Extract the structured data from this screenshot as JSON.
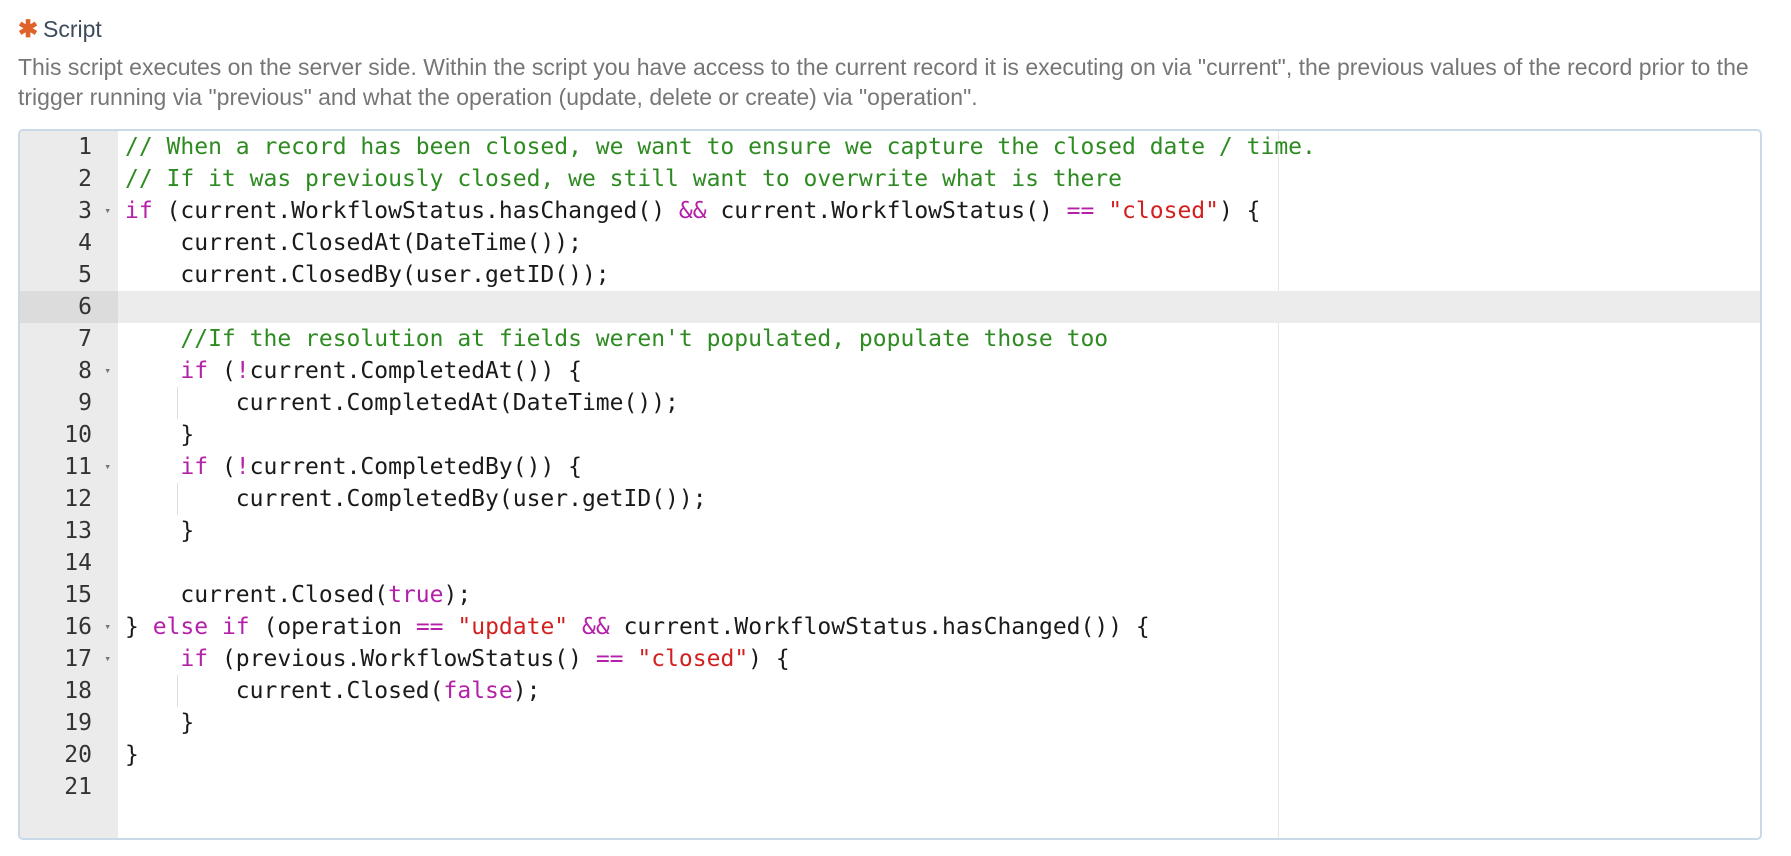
{
  "field": {
    "required_marker": "✱",
    "label": "Script",
    "description": "This script executes on the server side. Within the script you have access to the current record it is executing on via \"current\", the previous values of the record prior to the trigger running via \"previous\" and what the operation (update, delete or create) via \"operation\"."
  },
  "editor": {
    "active_line": 6,
    "lines": [
      {
        "n": "1",
        "fold": false,
        "indent": 0,
        "tokens": [
          [
            "// When a record has been closed, we want to ensure we capture the closed date / time.",
            "comment"
          ]
        ]
      },
      {
        "n": "2",
        "fold": false,
        "indent": 0,
        "tokens": [
          [
            "// If it was previously closed, we still want to overwrite what is there",
            "comment"
          ]
        ]
      },
      {
        "n": "3",
        "fold": true,
        "indent": 0,
        "tokens": [
          [
            "if",
            "keyword"
          ],
          [
            " (current.WorkflowStatus.hasChanged() ",
            "plain"
          ],
          [
            "&&",
            "op"
          ],
          [
            " current.WorkflowStatus() ",
            "plain"
          ],
          [
            "==",
            "op"
          ],
          [
            " ",
            "plain"
          ],
          [
            "\"closed\"",
            "string"
          ],
          [
            ") {",
            "plain"
          ]
        ]
      },
      {
        "n": "4",
        "fold": false,
        "indent": 1,
        "tokens": [
          [
            "    current.ClosedAt(DateTime());",
            "plain"
          ]
        ]
      },
      {
        "n": "5",
        "fold": false,
        "indent": 1,
        "tokens": [
          [
            "    current.ClosedBy(user.getID());",
            "plain"
          ]
        ]
      },
      {
        "n": "6",
        "fold": false,
        "indent": 1,
        "tokens": []
      },
      {
        "n": "7",
        "fold": false,
        "indent": 1,
        "tokens": [
          [
            "    ",
            "plain"
          ],
          [
            "//If the resolution at fields weren't populated, populate those too",
            "comment"
          ]
        ]
      },
      {
        "n": "8",
        "fold": true,
        "indent": 1,
        "tokens": [
          [
            "    ",
            "plain"
          ],
          [
            "if",
            "keyword"
          ],
          [
            " (",
            "plain"
          ],
          [
            "!",
            "op"
          ],
          [
            "current.CompletedAt()) {",
            "plain"
          ]
        ]
      },
      {
        "n": "9",
        "fold": false,
        "indent": 2,
        "tokens": [
          [
            "        current.CompletedAt(DateTime());",
            "plain"
          ]
        ]
      },
      {
        "n": "10",
        "fold": false,
        "indent": 1,
        "tokens": [
          [
            "    }",
            "plain"
          ]
        ]
      },
      {
        "n": "11",
        "fold": true,
        "indent": 1,
        "tokens": [
          [
            "    ",
            "plain"
          ],
          [
            "if",
            "keyword"
          ],
          [
            " (",
            "plain"
          ],
          [
            "!",
            "op"
          ],
          [
            "current.CompletedBy()) {",
            "plain"
          ]
        ]
      },
      {
        "n": "12",
        "fold": false,
        "indent": 2,
        "tokens": [
          [
            "        current.CompletedBy(user.getID());",
            "plain"
          ]
        ]
      },
      {
        "n": "13",
        "fold": false,
        "indent": 1,
        "tokens": [
          [
            "    }",
            "plain"
          ]
        ]
      },
      {
        "n": "14",
        "fold": false,
        "indent": 1,
        "tokens": []
      },
      {
        "n": "15",
        "fold": false,
        "indent": 1,
        "tokens": [
          [
            "    current.Closed(",
            "plain"
          ],
          [
            "true",
            "keyword"
          ],
          [
            ");",
            "plain"
          ]
        ]
      },
      {
        "n": "16",
        "fold": true,
        "indent": 0,
        "tokens": [
          [
            "} ",
            "plain"
          ],
          [
            "else if",
            "keyword"
          ],
          [
            " (operation ",
            "plain"
          ],
          [
            "==",
            "op"
          ],
          [
            " ",
            "plain"
          ],
          [
            "\"update\"",
            "string"
          ],
          [
            " ",
            "plain"
          ],
          [
            "&&",
            "op"
          ],
          [
            " current.WorkflowStatus.hasChanged()) {",
            "plain"
          ]
        ]
      },
      {
        "n": "17",
        "fold": true,
        "indent": 1,
        "tokens": [
          [
            "    ",
            "plain"
          ],
          [
            "if",
            "keyword"
          ],
          [
            " (previous.WorkflowStatus() ",
            "plain"
          ],
          [
            "==",
            "op"
          ],
          [
            " ",
            "plain"
          ],
          [
            "\"closed\"",
            "string"
          ],
          [
            ") {",
            "plain"
          ]
        ]
      },
      {
        "n": "18",
        "fold": false,
        "indent": 2,
        "tokens": [
          [
            "        current.Closed(",
            "plain"
          ],
          [
            "false",
            "keyword"
          ],
          [
            ");",
            "plain"
          ]
        ]
      },
      {
        "n": "19",
        "fold": false,
        "indent": 1,
        "tokens": [
          [
            "    }",
            "plain"
          ]
        ]
      },
      {
        "n": "20",
        "fold": false,
        "indent": 0,
        "tokens": [
          [
            "}",
            "plain"
          ]
        ]
      },
      {
        "n": "21",
        "fold": false,
        "indent": 0,
        "tokens": []
      }
    ],
    "fold_glyph": "▾"
  }
}
